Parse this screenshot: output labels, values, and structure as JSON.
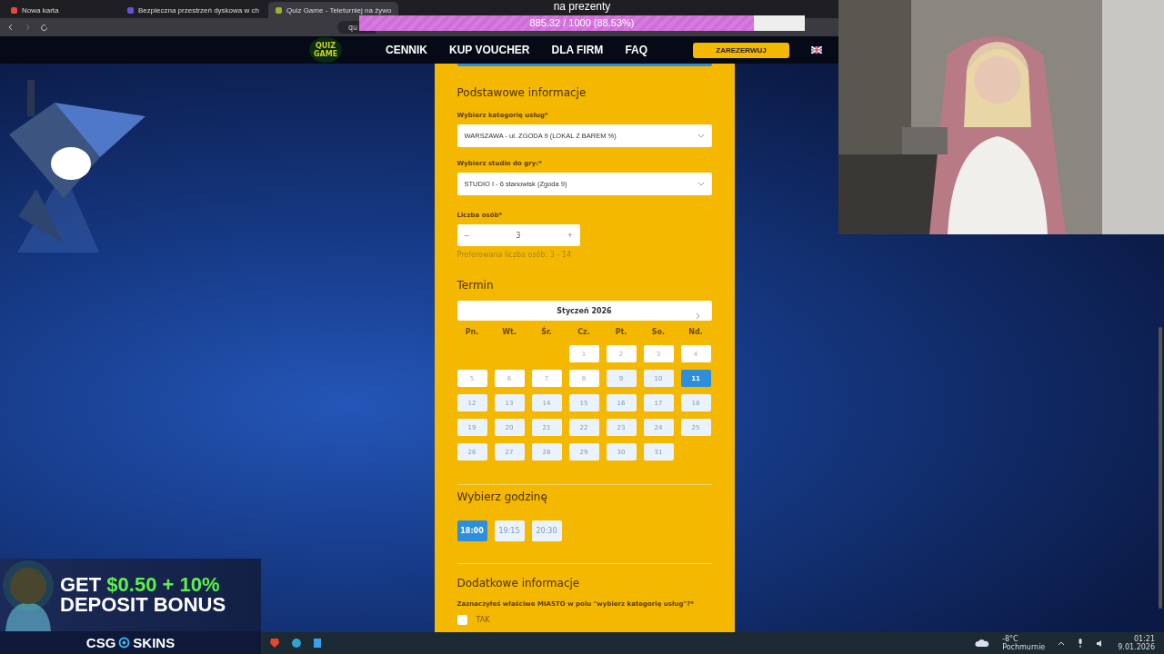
{
  "browser": {
    "tabs": [
      {
        "title": "Nowa karta",
        "selected": false
      },
      {
        "title": "Bezpieczna przestrzeń dyskowa w ch",
        "selected": false
      },
      {
        "title": "Quiz Game - Teleturniej na żywo",
        "selected": true
      }
    ],
    "address": "qu"
  },
  "site": {
    "logo": [
      "QUIZ",
      "GAME"
    ],
    "nav": [
      "CENNIK",
      "KUP VOUCHER",
      "DLA FIRM",
      "FAQ"
    ],
    "cta": "ZAREZERWUJ"
  },
  "form": {
    "basic": {
      "title": "Podstawowe informacje",
      "selects": [
        {
          "label": "Wybierz kategorię usług*",
          "value": "WARSZAWA - ul. ZGODA 9 (LOKAL Z BAREM %)"
        },
        {
          "label": "Wybierz studio do gry:*",
          "value": "STUDIO I - 6 stanowisk (Zgoda 9)"
        }
      ],
      "people": {
        "label": "Liczba osób*",
        "minus": "–",
        "value": "3",
        "plus": "+",
        "hint": "Preferowana liczba osób: 3 - 14"
      }
    },
    "calendar": {
      "title": "Termin",
      "month": "Styczeń 2026",
      "weekdays": [
        "Pn.",
        "Wt.",
        "Śr.",
        "Cz.",
        "Pt.",
        "So.",
        "Nd."
      ],
      "days": [
        {
          "kind": "blank"
        },
        {
          "kind": "blank"
        },
        {
          "kind": "blank"
        },
        {
          "kind": "day",
          "label": "1",
          "disabled": true,
          "selected": false
        },
        {
          "kind": "day",
          "label": "2",
          "disabled": true,
          "selected": false
        },
        {
          "kind": "day",
          "label": "3",
          "disabled": true,
          "selected": false
        },
        {
          "kind": "day",
          "label": "4",
          "disabled": true,
          "selected": false
        },
        {
          "kind": "day",
          "label": "5",
          "disabled": true,
          "selected": false
        },
        {
          "kind": "day",
          "label": "6",
          "disabled": true,
          "selected": false
        },
        {
          "kind": "day",
          "label": "7",
          "disabled": true,
          "selected": false
        },
        {
          "kind": "day",
          "label": "8",
          "disabled": true,
          "selected": false
        },
        {
          "kind": "day",
          "label": "9",
          "disabled": false,
          "selected": false
        },
        {
          "kind": "day",
          "label": "10",
          "disabled": false,
          "selected": false
        },
        {
          "kind": "day",
          "label": "11",
          "disabled": false,
          "selected": true
        },
        {
          "kind": "day",
          "label": "12",
          "disabled": false,
          "selected": false
        },
        {
          "kind": "day",
          "label": "13",
          "disabled": false,
          "selected": false
        },
        {
          "kind": "day",
          "label": "14",
          "disabled": false,
          "selected": false
        },
        {
          "kind": "day",
          "label": "15",
          "disabled": false,
          "selected": false
        },
        {
          "kind": "day",
          "label": "16",
          "disabled": false,
          "selected": false
        },
        {
          "kind": "day",
          "label": "17",
          "disabled": false,
          "selected": false
        },
        {
          "kind": "day",
          "label": "18",
          "disabled": false,
          "selected": false
        },
        {
          "kind": "day",
          "label": "19",
          "disabled": false,
          "selected": false
        },
        {
          "kind": "day",
          "label": "20",
          "disabled": false,
          "selected": false
        },
        {
          "kind": "day",
          "label": "21",
          "disabled": false,
          "selected": false
        },
        {
          "kind": "day",
          "label": "22",
          "disabled": false,
          "selected": false
        },
        {
          "kind": "day",
          "label": "23",
          "disabled": false,
          "selected": false
        },
        {
          "kind": "day",
          "label": "24",
          "disabled": false,
          "selected": false
        },
        {
          "kind": "day",
          "label": "25",
          "disabled": false,
          "selected": false
        },
        {
          "kind": "day",
          "label": "26",
          "disabled": false,
          "selected": false
        },
        {
          "kind": "day",
          "label": "27",
          "disabled": false,
          "selected": false
        },
        {
          "kind": "day",
          "label": "28",
          "disabled": false,
          "selected": false
        },
        {
          "kind": "day",
          "label": "29",
          "disabled": false,
          "selected": false
        },
        {
          "kind": "day",
          "label": "30",
          "disabled": false,
          "selected": false
        },
        {
          "kind": "day",
          "label": "31",
          "disabled": false,
          "selected": false
        }
      ]
    },
    "hours": {
      "title": "Wybierz godzinę",
      "times": [
        {
          "label": "18:00",
          "selected": true
        },
        {
          "label": "19:15",
          "selected": false
        },
        {
          "label": "20:30",
          "selected": false
        }
      ]
    },
    "extra": {
      "title": "Dodatkowe informacje",
      "question": "Zaznaczyłeś właściwe MIASTO w polu \"wybierz kategorię usług\"?*",
      "option": {
        "label": "TAK",
        "checked": false
      }
    }
  },
  "goal": {
    "title": "na prezenty",
    "reading": "885.32 / 1000 (88.53%)",
    "level": 0.8853
  },
  "ad": {
    "line1": "GET",
    "amount": "$0.50 + 10%",
    "line2": "DEPOSIT BONUS",
    "brand": [
      "CSG",
      "SKINS"
    ]
  },
  "taskbar": {
    "temperature": "-8°C",
    "weather": "Pochmurnie",
    "time": "01:21",
    "date": "9.01.2026"
  }
}
